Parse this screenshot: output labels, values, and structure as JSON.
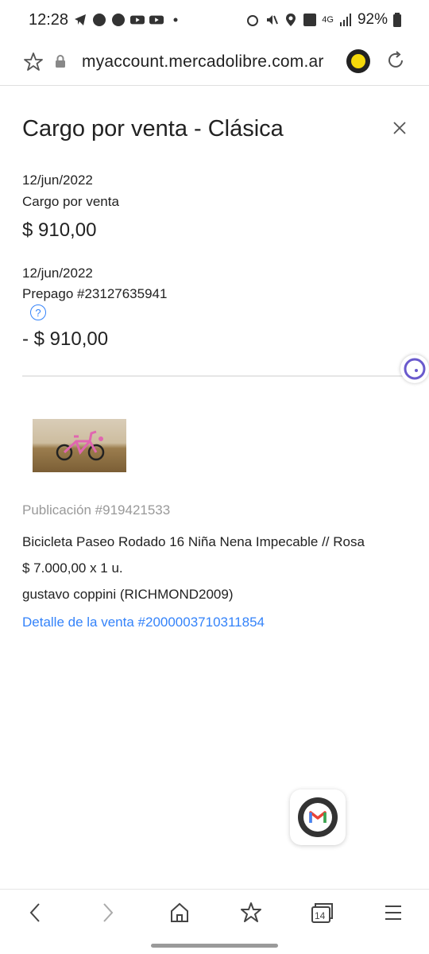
{
  "status": {
    "time": "12:28",
    "battery": "92%",
    "network": "4G"
  },
  "browser": {
    "url": "myaccount.mercadolibre.com.ar",
    "tab_count": "14"
  },
  "panel": {
    "title": "Cargo por venta - Clásica",
    "charge": {
      "date": "12/jun/2022",
      "label": "Cargo por venta",
      "amount": "$ 910,00"
    },
    "prepay": {
      "date": "12/jun/2022",
      "label": "Prepago #23127635941",
      "help": "?",
      "amount": "- $ 910,00"
    },
    "publication": {
      "id_label": "Publicación #919421533",
      "title": "Bicicleta Paseo Rodado 16 Niña Nena Impecable // Rosa",
      "price": "$ 7.000,00 x 1 u.",
      "buyer": "gustavo coppini (RICHMOND2009)",
      "sale_link": "Detalle de la venta #2000003710311854"
    }
  },
  "colors": {
    "link": "#3483fa",
    "muted": "#999999",
    "text": "#222222"
  }
}
